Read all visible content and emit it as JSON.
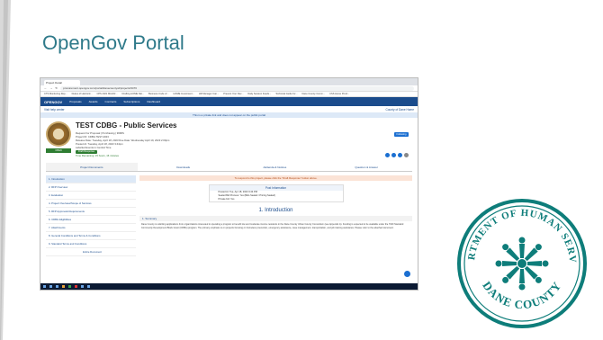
{
  "slide": {
    "title": "OpenGov Portal"
  },
  "browser": {
    "tab_title": "Project Detail",
    "url": "procurement.opengov.com/portal/danecountywi/projects/9476"
  },
  "bookmarks": [
    "CTS Monitoring Rep...",
    "Dukes of Hazzard...",
    "CPS 2021 MindOr...",
    "Drafting HOME Dat...",
    "Business Code of...",
    "HOME Investment...",
    "HR Manager Can...",
    "Prevent Your Dev...",
    "Daily Session Feeds...",
    "Technical Guide for...",
    "Dane County Comm...",
    "CSS Home Proof..."
  ],
  "nav": {
    "logo": "OPENGOV",
    "items": [
      "Proposals",
      "Awards",
      "Contracts",
      "Subscriptions",
      "Dashboard"
    ]
  },
  "subnav": {
    "left": "Visit help center",
    "right": "County of Dane Home"
  },
  "banner": "This is a private link and does not appear on the public portal",
  "project": {
    "title": "TEST CDBG - Public Services",
    "lines": [
      "Request For Proposal | Purchasing | 9696S",
      "Project ID: CDBG TEST-2023",
      "Release Date: Tuesday, April 18, 2023   Due Date: Wednesday April 19, 2023 2:00pm",
      "Posted At: Tuesday, April 18, 2023 3:44pm",
      "Labelled Events in Central Time"
    ],
    "badge": "OPEN",
    "button_response": "Draft Response",
    "button_follow": "Following",
    "time_remaining": "Time Remaining: 15 hours, 16 minutes"
  },
  "doc_tabs": [
    "Project Documents",
    "Downloads",
    "Addenda & Notices",
    "Question & Answer"
  ],
  "toc": [
    "1. Introduction",
    "2. RFP Overview",
    "3. Evaluation",
    "4. Project Overview/Scope of Services",
    "5. RFP Approvals Requirements",
    "6. CDBG Eligibilities",
    "7. Attachments",
    "8. General Conditions and Terms & Conditions",
    "9. Standard Terms and Conditions"
  ],
  "toc_footer": "Entire Document",
  "alert": "To respond to this project, please click the \"Draft Response\" button above.",
  "post_info": {
    "header": "Post Information",
    "rows": [
      "Posted At:  Tue, Apr 18, 2023 3:44 PM",
      "Sealed Bid Process:  Yes (Bids Sealed / Pricing Sealed)",
      "Private bid:  Yes"
    ]
  },
  "section_title": "1. Introduction",
  "summary_label": "1. Summary",
  "paragraph": "Dane County is soliciting applications from organizations interested in operating a program to benefit low and moderate income residents in the Dane County Urban County Consortium (see Appendix A). Funding is expected to be available under the HUD Standard Community Development Block Grant (CDBG) program. The primary emphasis is on projects focusing on homeless prevention, emergency assistance, case management, transportation, and job training assistance. Please refer to the attached document.",
  "logo": {
    "top_text": "DEPARTMENT OF HUMAN SERVICES",
    "bottom_text": "DANE COUNTY"
  },
  "colors": {
    "title": "#2f7a8a",
    "nav": "#1b4c8c",
    "accent": "#1b6fd1",
    "logo_teal": "#0e7d7a"
  }
}
